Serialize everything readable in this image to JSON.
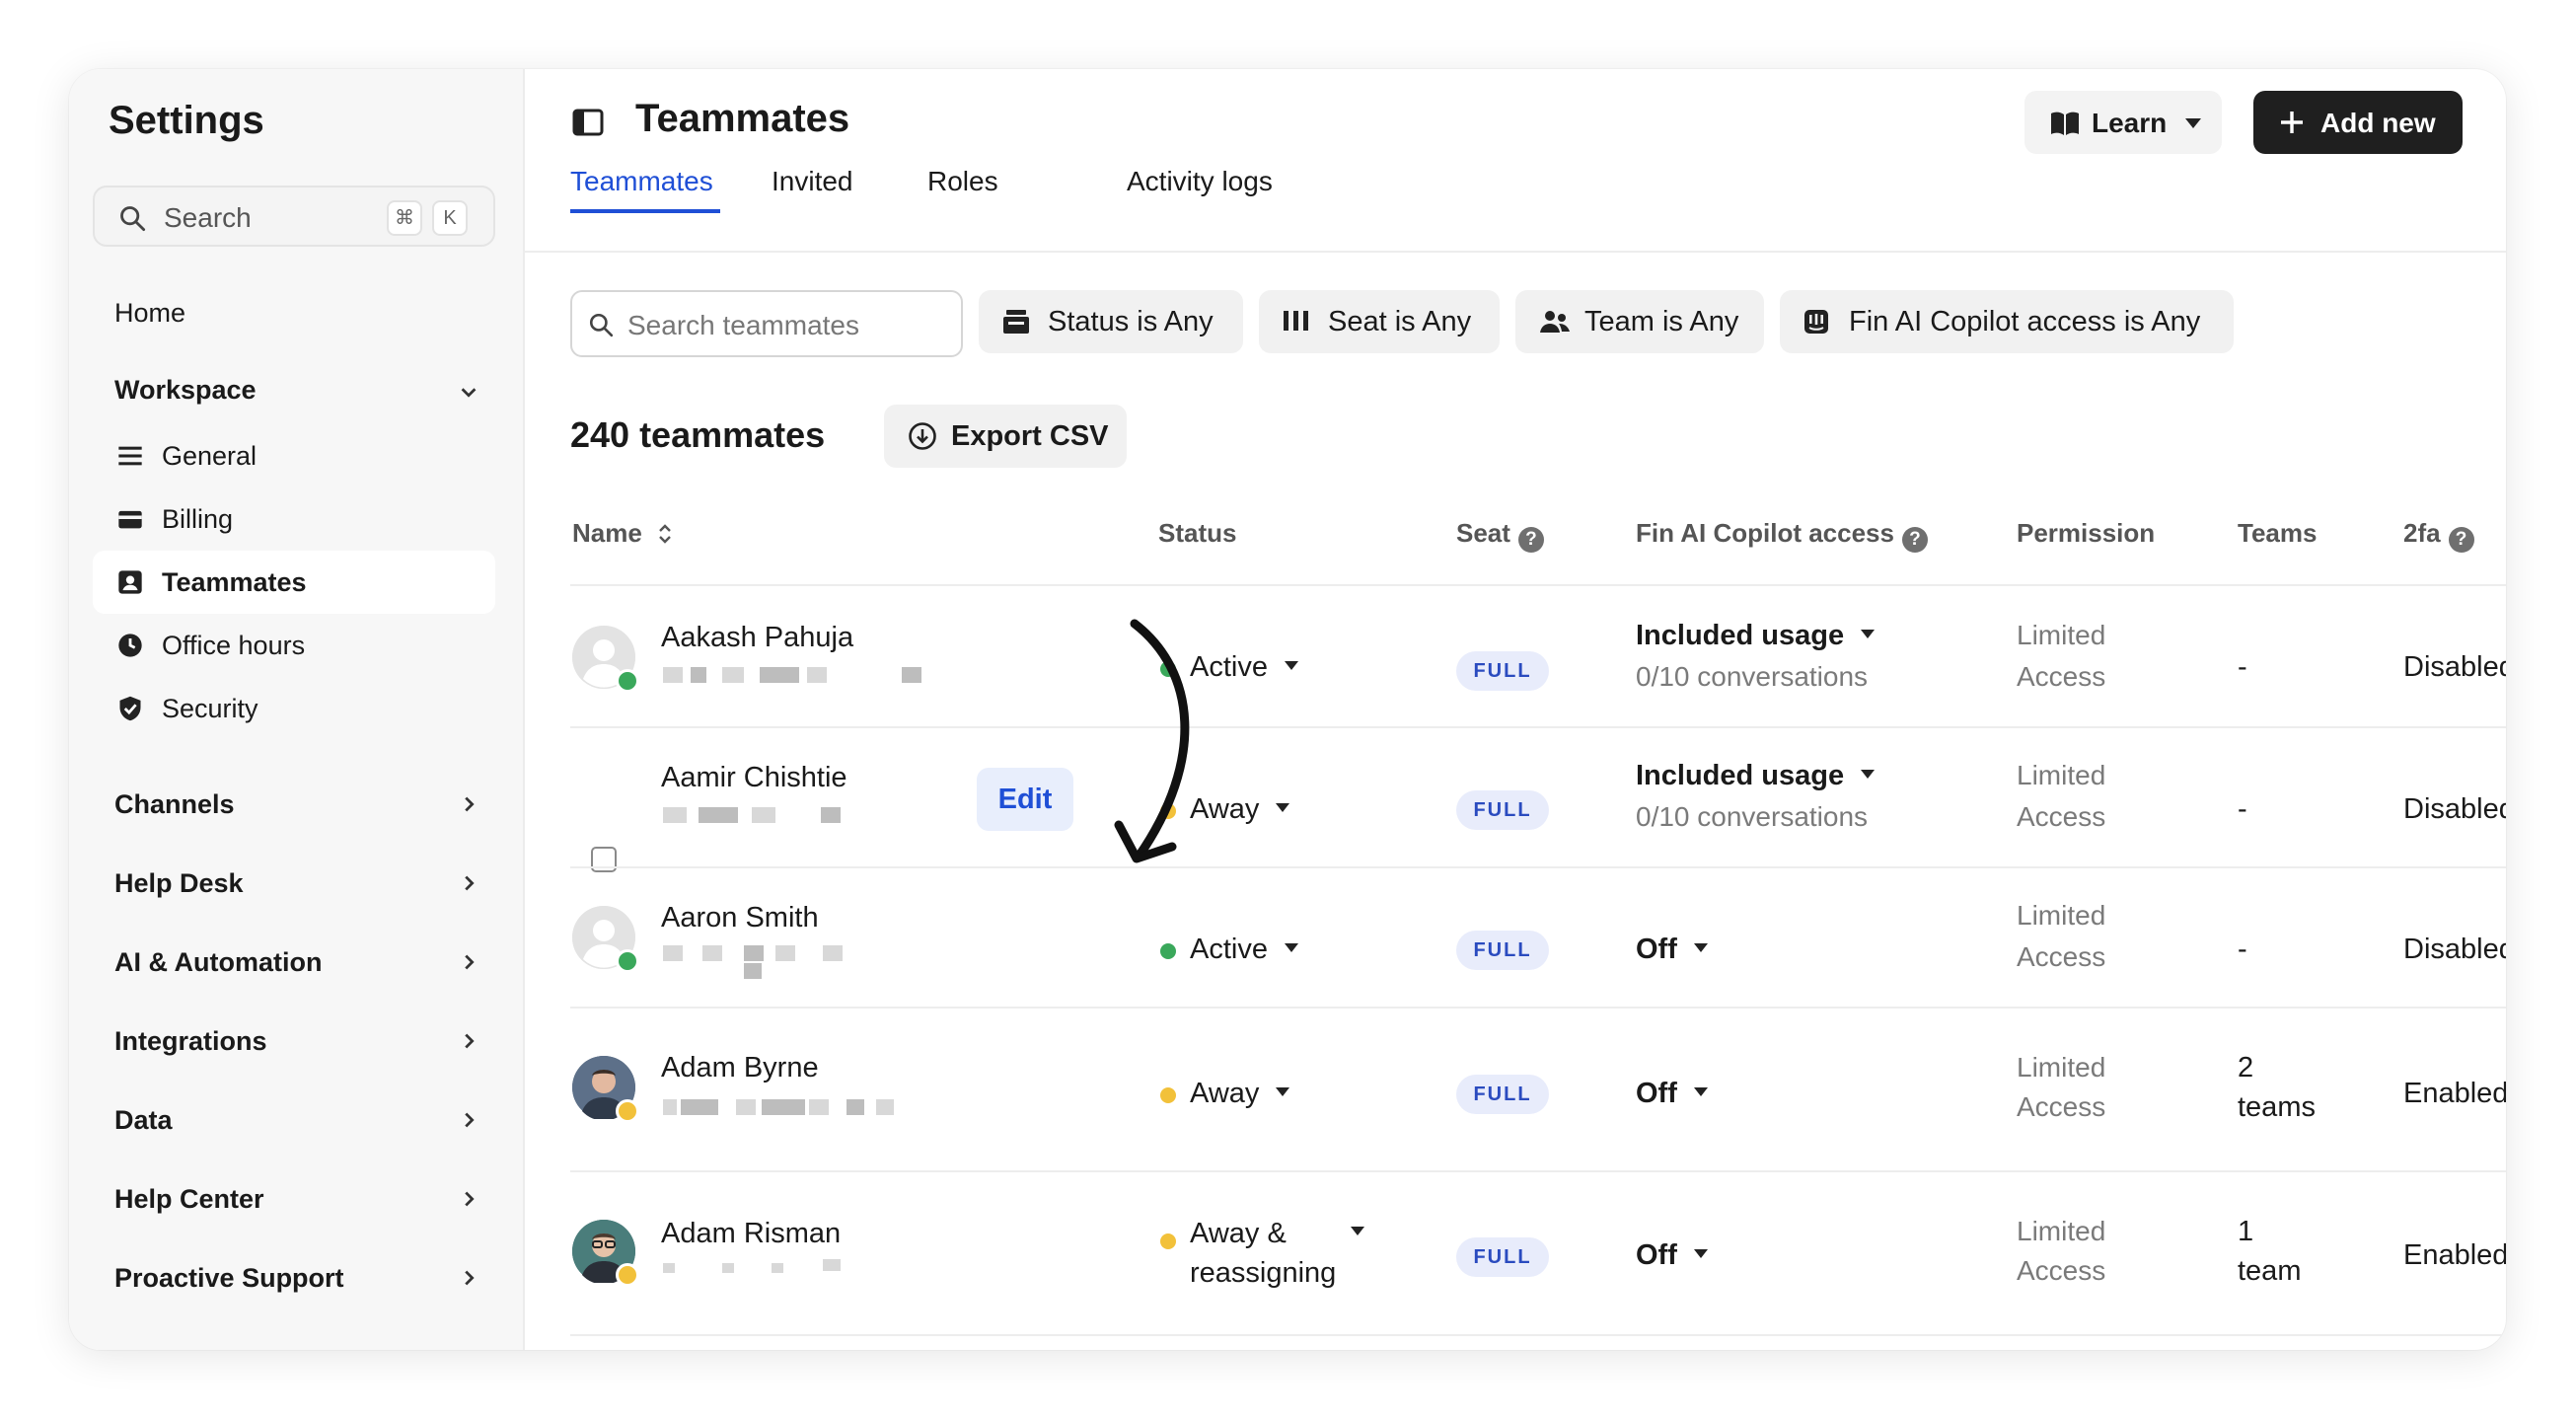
{
  "sidebar": {
    "title": "Settings",
    "search_label": "Search",
    "kbd_cmd": "⌘",
    "kbd_k": "K",
    "home": "Home",
    "workspace": "Workspace",
    "workspace_items": [
      "General",
      "Billing",
      "Teammates",
      "Office hours",
      "Security"
    ],
    "sections": [
      "Channels",
      "Help Desk",
      "AI & Automation",
      "Integrations",
      "Data",
      "Help Center",
      "Proactive Support"
    ]
  },
  "header": {
    "title": "Teammates",
    "learn_label": "Learn",
    "add_label": "Add new"
  },
  "tabs": [
    "Teammates",
    "Invited",
    "Roles",
    "Activity logs"
  ],
  "filters": {
    "search_placeholder": "Search teammates",
    "status": "Status is Any",
    "seat": "Seat is Any",
    "team": "Team is Any",
    "copilot": "Fin AI Copilot access is Any"
  },
  "count_label": "240 teammates",
  "export_label": "Export CSV",
  "columns": {
    "name": "Name",
    "status": "Status",
    "seat": "Seat",
    "copilot": "Fin AI Copilot access",
    "permission": "Permission",
    "teams": "Teams",
    "twofa": "2fa"
  },
  "edit_label": "Edit",
  "rows": [
    {
      "name": "Aakash Pahuja",
      "status": "Active",
      "seat": "FULL",
      "copilot": "Included usage",
      "copilot_sub": "0/10 conversations",
      "permission": [
        "Limited",
        "Access"
      ],
      "teams": [
        "-",
        ""
      ],
      "twofa": "Disabled"
    },
    {
      "name": "Aamir Chishtie",
      "status": "Away",
      "seat": "FULL",
      "copilot": "Included usage",
      "copilot_sub": "0/10 conversations",
      "permission": [
        "Limited",
        "Access"
      ],
      "teams": [
        "-",
        ""
      ],
      "twofa": "Disabled"
    },
    {
      "name": "Aaron Smith",
      "status": "Active",
      "seat": "FULL",
      "copilot": "Off",
      "copilot_sub": "",
      "permission": [
        "Limited",
        "Access"
      ],
      "teams": [
        "-",
        ""
      ],
      "twofa": "Disabled"
    },
    {
      "name": "Adam Byrne",
      "status": "Away",
      "seat": "FULL",
      "copilot": "Off",
      "copilot_sub": "",
      "permission": [
        "Limited",
        "Access"
      ],
      "teams": [
        "2",
        "teams"
      ],
      "twofa": "Enabled"
    },
    {
      "name": "Adam Risman",
      "status": "Away &",
      "status2": "reassigning",
      "seat": "FULL",
      "copilot": "Off",
      "copilot_sub": "",
      "permission": [
        "Limited",
        "Access"
      ],
      "teams": [
        "1",
        "team"
      ],
      "twofa": "Enabled"
    }
  ],
  "colors": {
    "accent": "#1f4fd6",
    "active": "#3aa85b",
    "away": "#f2c13a",
    "badge_bg": "#e8ecfb",
    "badge_text": "#2a4bbf"
  }
}
